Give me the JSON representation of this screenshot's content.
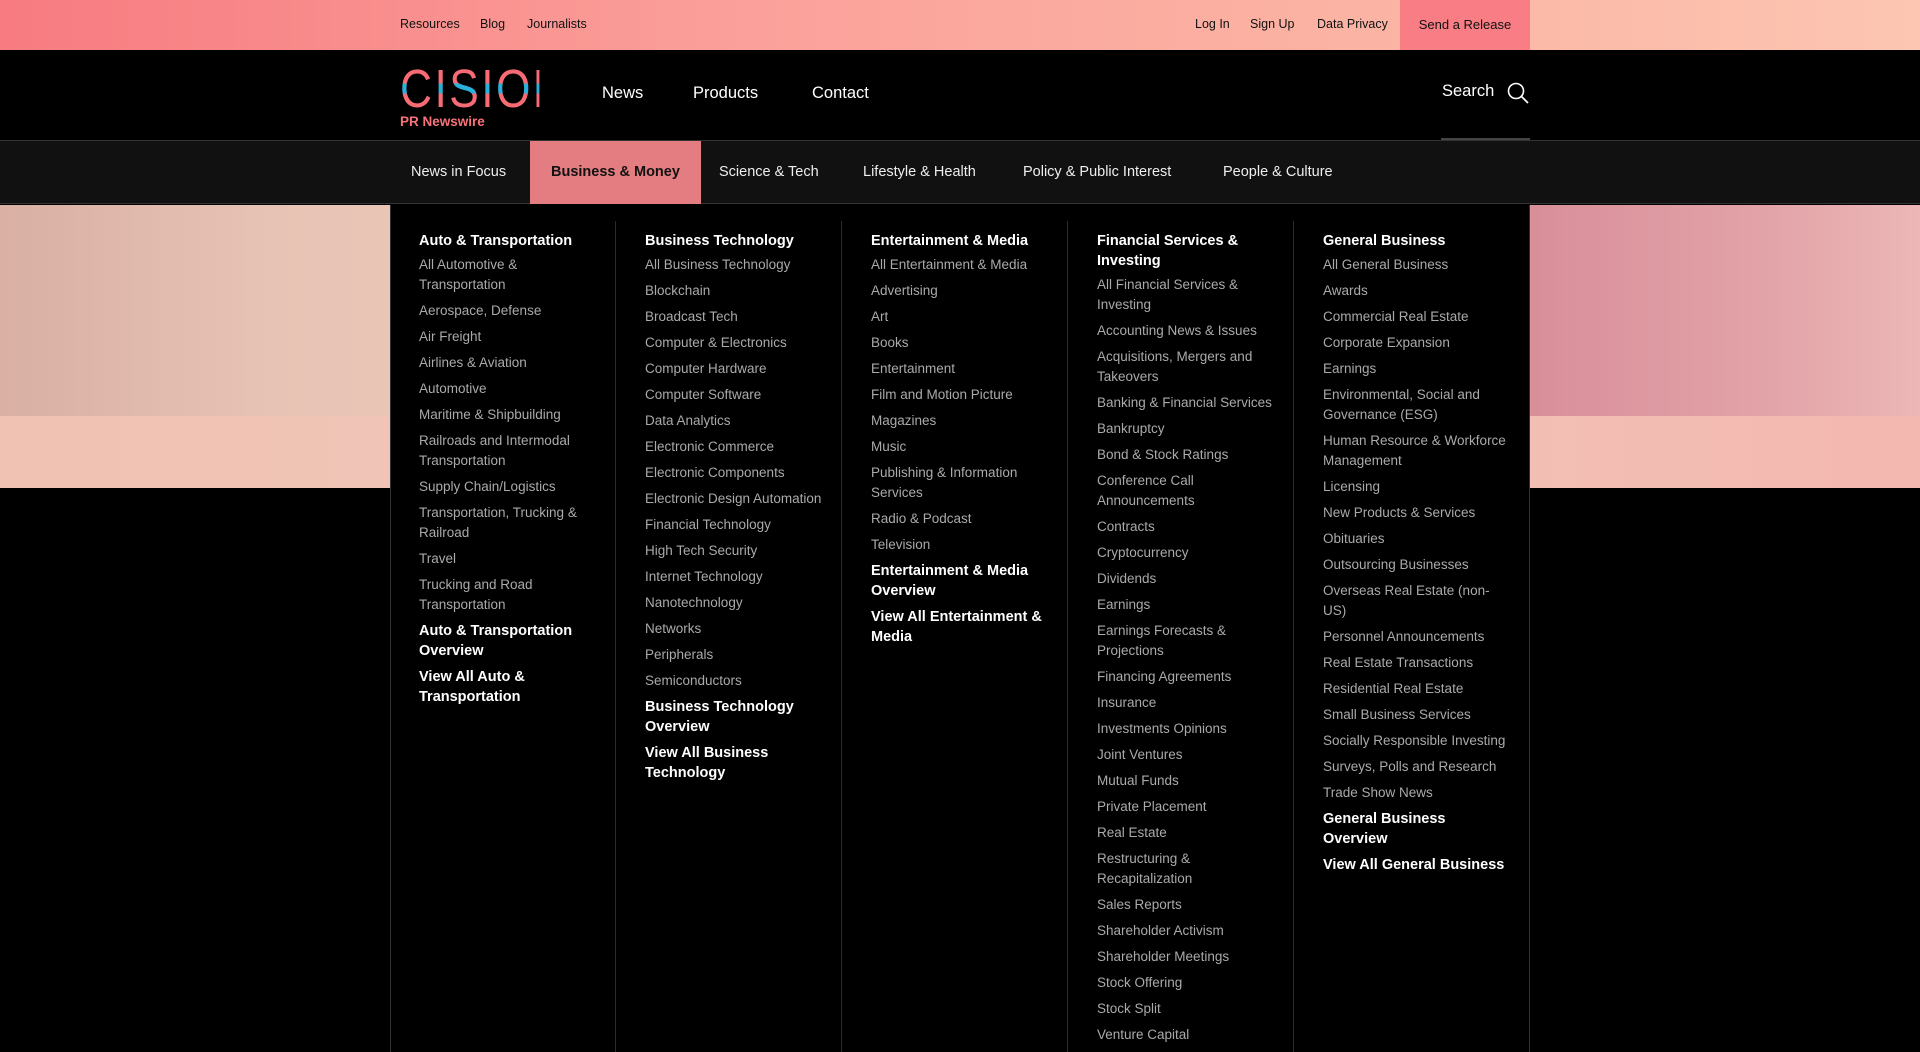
{
  "topbar": {
    "left_links": [
      "Resources",
      "Blog",
      "Journalists"
    ],
    "right_links": [
      "Log In",
      "Sign Up",
      "Data Privacy"
    ],
    "cta": "Send a Release"
  },
  "header": {
    "logo_word": "CISION",
    "logo_sub": "PR Newswire",
    "nav": [
      "News",
      "Products",
      "Contact"
    ],
    "search_label": "Search"
  },
  "categories": {
    "items": [
      "News in Focus",
      "Business & Money",
      "Science & Tech",
      "Lifestyle & Health",
      "Policy & Public Interest",
      "People & Culture"
    ],
    "active": "Business & Money"
  },
  "mega_menu": {
    "columns": [
      {
        "title": "Auto & Transportation",
        "items": [
          "All Automotive & Transportation",
          "Aerospace, Defense",
          "Air Freight",
          "Airlines & Aviation",
          "Automotive",
          "Maritime & Shipbuilding",
          "Railroads and Intermodal Transportation",
          "Supply Chain/Logistics",
          "Transportation, Trucking & Railroad",
          "Travel",
          "Trucking and Road Transportation"
        ],
        "overview": "Auto & Transportation Overview",
        "view_all": "View All Auto & Transportation"
      },
      {
        "title": "Business Technology",
        "items": [
          "All Business Technology",
          "Blockchain",
          "Broadcast Tech",
          "Computer & Electronics",
          "Computer Hardware",
          "Computer Software",
          "Data Analytics",
          "Electronic Commerce",
          "Electronic Components",
          "Electronic Design Automation",
          "Financial Technology",
          "High Tech Security",
          "Internet Technology",
          "Nanotechnology",
          "Networks",
          "Peripherals",
          "Semiconductors"
        ],
        "overview": "Business Technology Overview",
        "view_all": "View All Business Technology"
      },
      {
        "title": "Entertainment & Media",
        "items": [
          "All Entertainment & Media",
          "Advertising",
          "Art",
          "Books",
          "Entertainment",
          "Film and Motion Picture",
          "Magazines",
          "Music",
          "Publishing & Information Services",
          "Radio & Podcast",
          "Television"
        ],
        "overview": "Entertainment & Media Overview",
        "view_all": "View All Entertainment & Media"
      },
      {
        "title": "Financial Services & Investing",
        "items": [
          "All Financial Services & Investing",
          "Accounting News & Issues",
          "Acquisitions, Mergers and Takeovers",
          "Banking & Financial Services",
          "Bankruptcy",
          "Bond & Stock Ratings",
          "Conference Call Announcements",
          "Contracts",
          "Cryptocurrency",
          "Dividends",
          "Earnings",
          "Earnings Forecasts & Projections",
          "Financing Agreements",
          "Insurance",
          "Investments Opinions",
          "Joint Ventures",
          "Mutual Funds",
          "Private Placement",
          "Real Estate",
          "Restructuring & Recapitalization",
          "Sales Reports",
          "Shareholder Activism",
          "Shareholder Meetings",
          "Stock Offering",
          "Stock Split",
          "Venture Capital"
        ],
        "overview": "",
        "view_all": ""
      },
      {
        "title": "General Business",
        "items": [
          "All General Business",
          "Awards",
          "Commercial Real Estate",
          "Corporate Expansion",
          "Earnings",
          "Environmental, Social and Governance (ESG)",
          "Human Resource & Workforce Management",
          "Licensing",
          "New Products & Services",
          "Obituaries",
          "Outsourcing Businesses",
          "Overseas Real Estate (non-US)",
          "Personnel Announcements",
          "Real Estate Transactions",
          "Residential Real Estate",
          "Small Business Services",
          "Socially Responsible Investing",
          "Surveys, Polls and Research",
          "Trade Show News"
        ],
        "overview": "General Business Overview",
        "view_all": "View All General Business"
      }
    ]
  }
}
